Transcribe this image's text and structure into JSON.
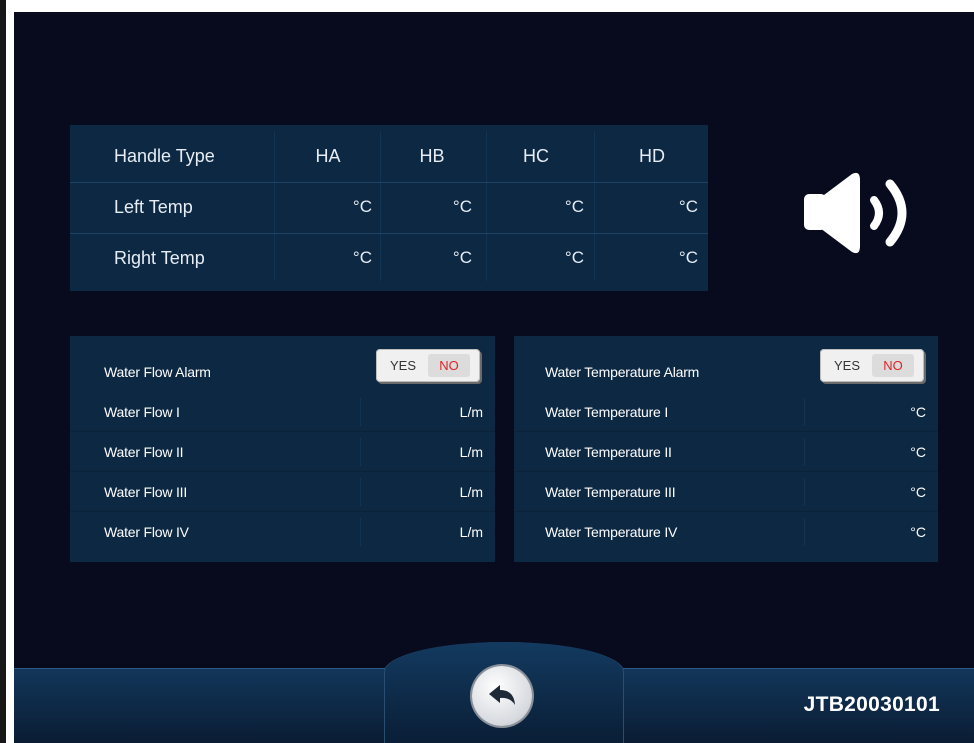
{
  "handle_table": {
    "header_label": "Handle Type",
    "columns": [
      "HA",
      "HB",
      "HC",
      "HD"
    ],
    "rows": [
      {
        "label": "Left Temp",
        "units": [
          "°C",
          "°C",
          "°C",
          "°C"
        ]
      },
      {
        "label": "Right Temp",
        "units": [
          "°C",
          "°C",
          "°C",
          "°C"
        ]
      }
    ]
  },
  "speaker": {
    "icon": "speaker-volume-icon",
    "state": "on"
  },
  "water_flow_panel": {
    "alarm_label": "Water Flow  Alarm",
    "toggle": {
      "yes": "YES",
      "no": "NO",
      "selected": "NO"
    },
    "rows": [
      {
        "label": "Water  Flow I",
        "unit": "L/m"
      },
      {
        "label": "Water  Flow II",
        "unit": "L/m"
      },
      {
        "label": "Water  Flow III",
        "unit": "L/m"
      },
      {
        "label": "Water  Flow IV",
        "unit": "L/m"
      }
    ]
  },
  "water_temp_panel": {
    "alarm_label": "Water Temperature Alarm",
    "toggle": {
      "yes": "YES",
      "no": "NO",
      "selected": "NO"
    },
    "rows": [
      {
        "label": "Water Temperature I",
        "unit": "°C"
      },
      {
        "label": "Water Temperature II",
        "unit": "°C"
      },
      {
        "label": "Water Temperature III",
        "unit": "°C"
      },
      {
        "label": "Water Temperature IV",
        "unit": "°C"
      }
    ]
  },
  "footer": {
    "back_icon": "back-arrow-icon",
    "device_id": "JTB20030101"
  },
  "colors": {
    "background": "#070b1d",
    "panel": "#0d2842",
    "toggle_no": "#e02424",
    "text": "#ffffff"
  }
}
